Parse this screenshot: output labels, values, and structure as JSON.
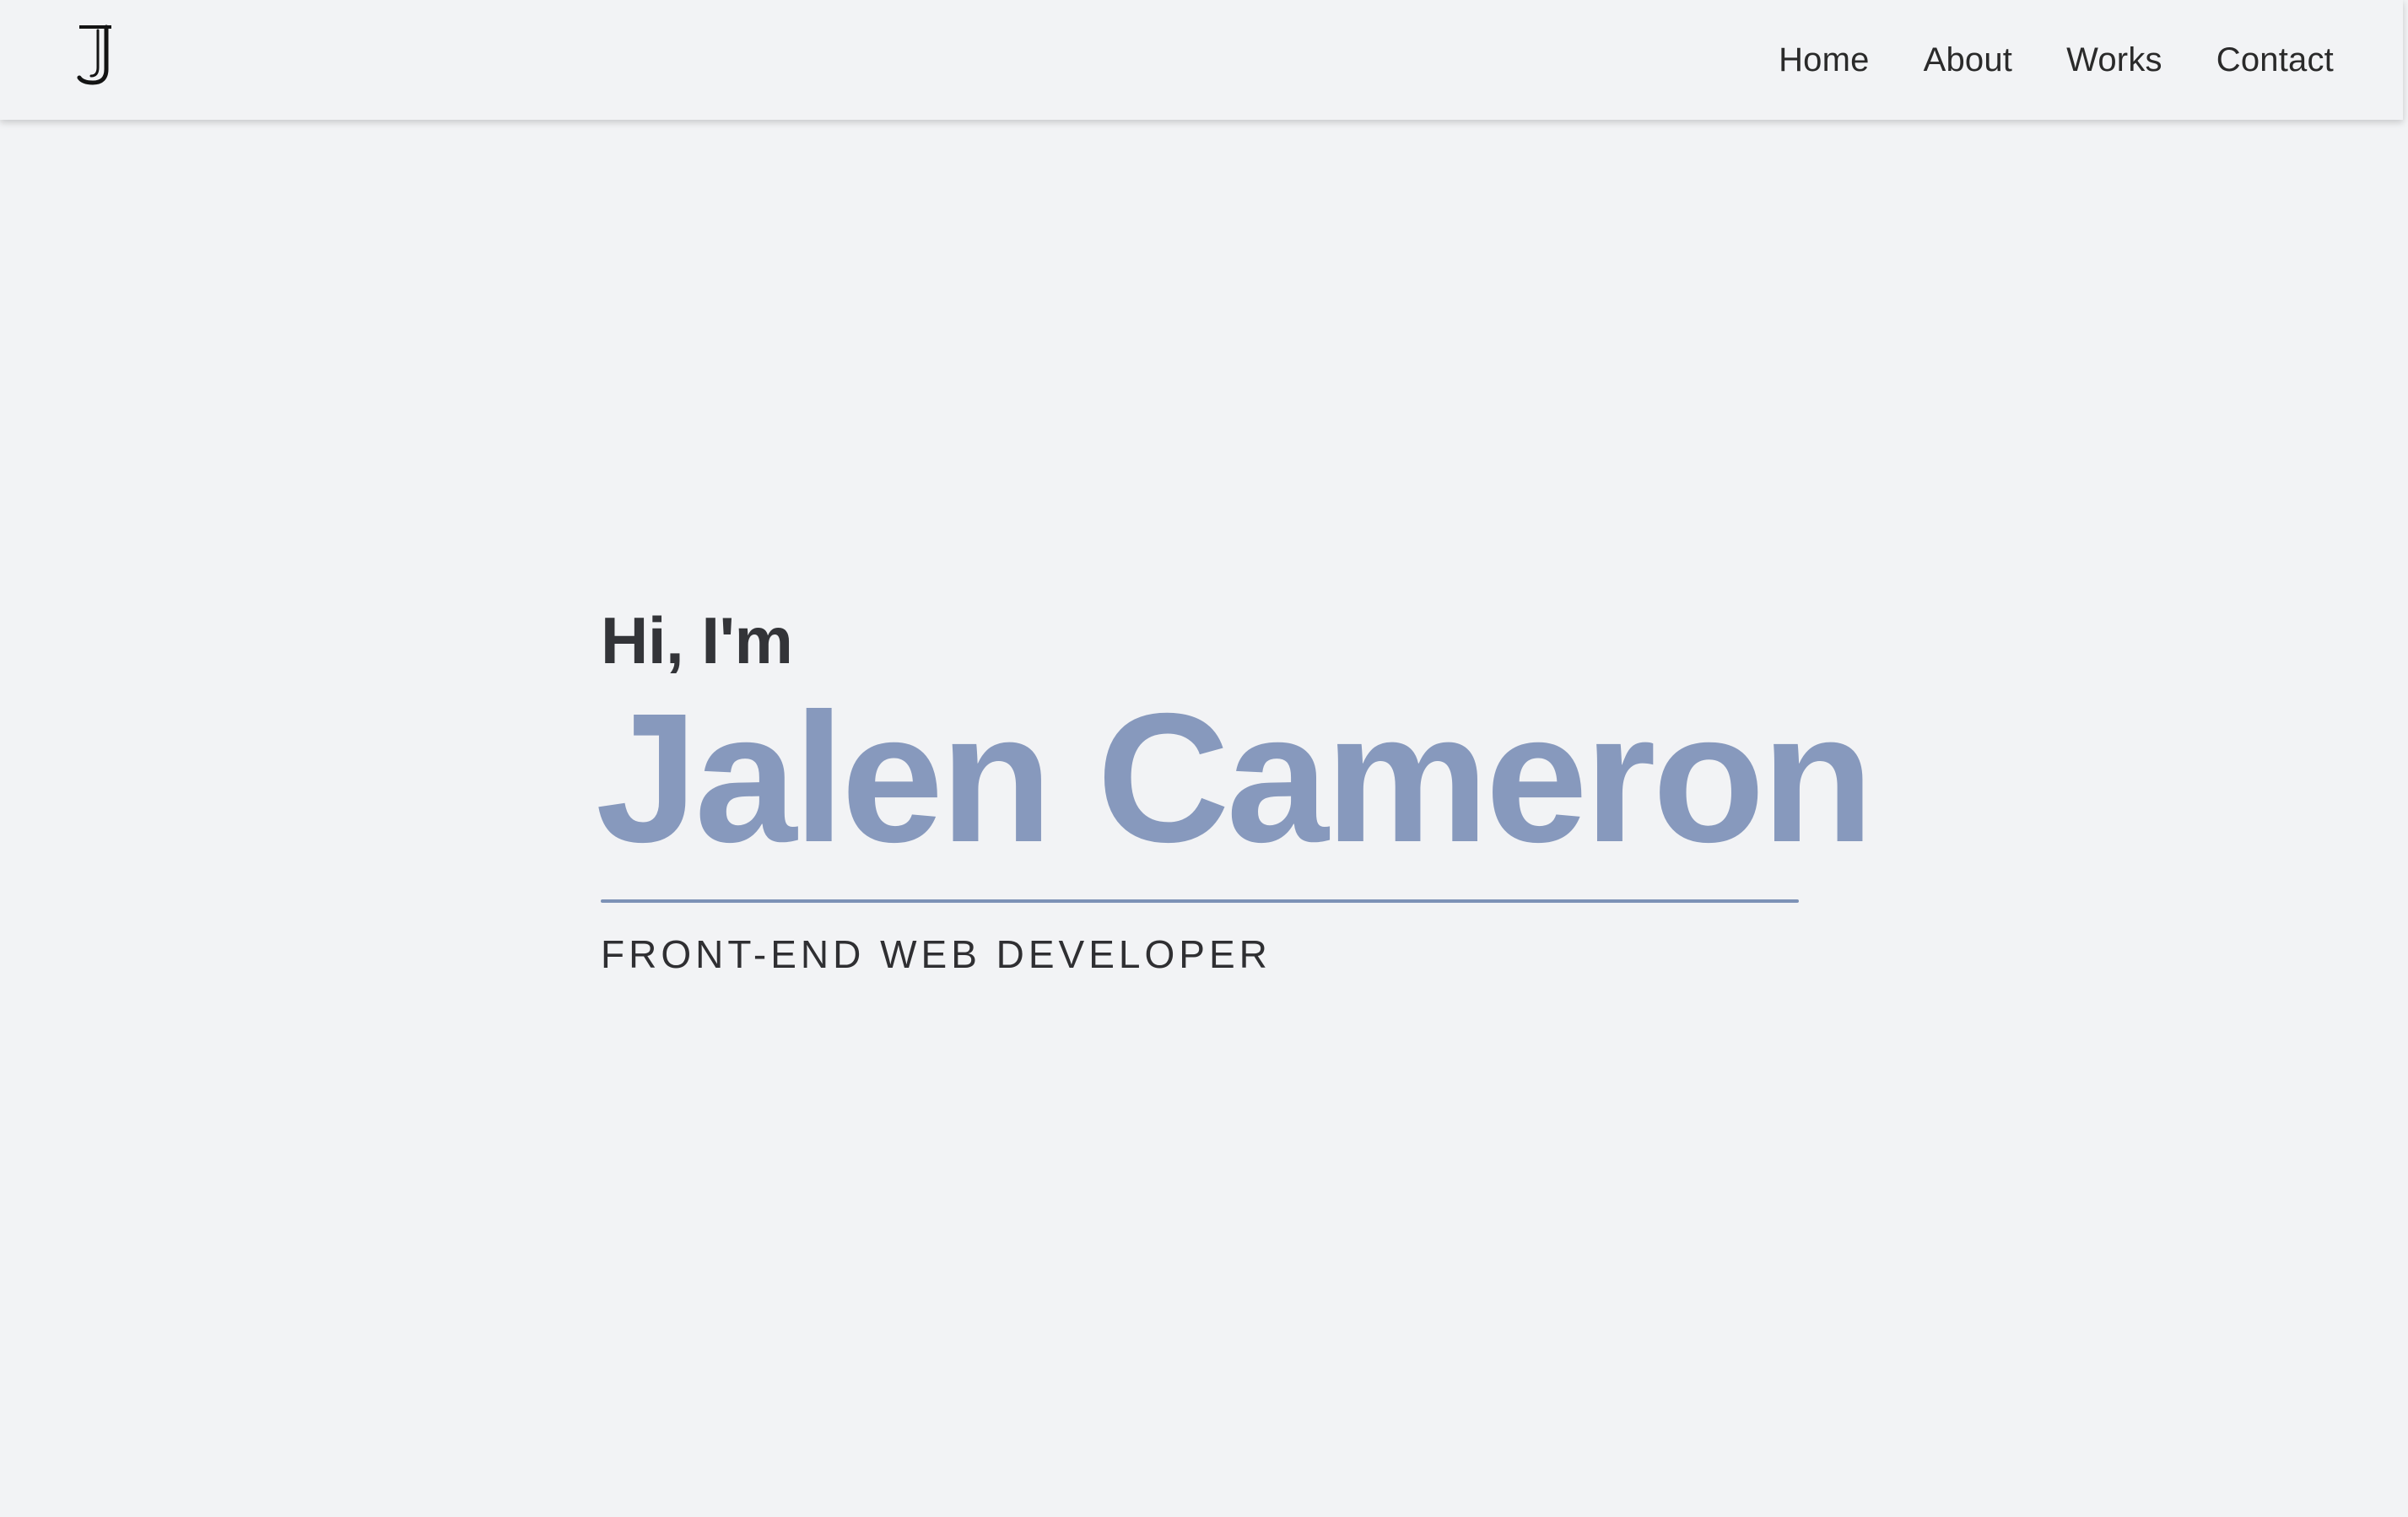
{
  "header": {
    "logo_icon": "j-monogram-icon",
    "nav": [
      {
        "label": "Home"
      },
      {
        "label": "About"
      },
      {
        "label": "Works"
      },
      {
        "label": "Contact"
      }
    ]
  },
  "hero": {
    "greeting": "Hi, I'm",
    "name": "Jalen Cameron",
    "role": "FRONT-END WEB DEVELOPER"
  },
  "colors": {
    "background": "#f2f3f5",
    "accent": "#8799bd",
    "text": "#333438"
  }
}
